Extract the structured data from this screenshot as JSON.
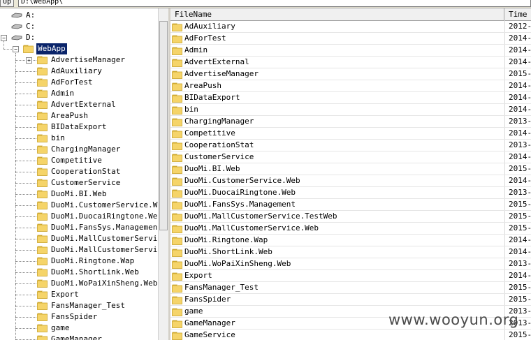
{
  "toolbar": {
    "up_label": "Up",
    "path": "D:\\WebApp\\"
  },
  "tree": {
    "drives": [
      {
        "label": "A:",
        "expanded": false
      },
      {
        "label": "C:",
        "expanded": false
      },
      {
        "label": "D:",
        "expanded": true
      }
    ],
    "selected_folder": "WebApp",
    "children": [
      {
        "label": "AdvertiseManager",
        "has_children": true
      },
      {
        "label": "AdAuxiliary"
      },
      {
        "label": "AdForTest"
      },
      {
        "label": "Admin"
      },
      {
        "label": "AdvertExternal"
      },
      {
        "label": "AreaPush"
      },
      {
        "label": "BIDataExport"
      },
      {
        "label": "bin"
      },
      {
        "label": "ChargingManager"
      },
      {
        "label": "Competitive"
      },
      {
        "label": "CooperationStat"
      },
      {
        "label": "CustomerService"
      },
      {
        "label": "DuoMi.BI.Web"
      },
      {
        "label": "DuoMi.CustomerService.Web"
      },
      {
        "label": "DuoMi.DuocaiRingtone.Web"
      },
      {
        "label": "DuoMi.FansSys.Management"
      },
      {
        "label": "DuoMi.MallCustomerService.TestWeb"
      },
      {
        "label": "DuoMi.MallCustomerService.Web"
      },
      {
        "label": "DuoMi.Ringtone.Wap"
      },
      {
        "label": "DuoMi.ShortLink.Web"
      },
      {
        "label": "DuoMi.WoPaiXinSheng.Web"
      },
      {
        "label": "Export"
      },
      {
        "label": "FansManager_Test"
      },
      {
        "label": "FansSpider"
      },
      {
        "label": "game"
      },
      {
        "label": "GameManager"
      }
    ]
  },
  "list": {
    "columns": [
      "FileName",
      "Time"
    ],
    "rows": [
      {
        "name": "AdAuxiliary",
        "time": "2012-"
      },
      {
        "name": "AdForTest",
        "time": "2014-"
      },
      {
        "name": "Admin",
        "time": "2014-"
      },
      {
        "name": "AdvertExternal",
        "time": "2014-"
      },
      {
        "name": "AdvertiseManager",
        "time": "2015-"
      },
      {
        "name": "AreaPush",
        "time": "2014-"
      },
      {
        "name": "BIDataExport",
        "time": "2014-"
      },
      {
        "name": "bin",
        "time": "2014-"
      },
      {
        "name": "ChargingManager",
        "time": "2013-"
      },
      {
        "name": "Competitive",
        "time": "2014-"
      },
      {
        "name": "CooperationStat",
        "time": "2013-"
      },
      {
        "name": "CustomerService",
        "time": "2014-"
      },
      {
        "name": "DuoMi.BI.Web",
        "time": "2015-"
      },
      {
        "name": "DuoMi.CustomerService.Web",
        "time": "2014-"
      },
      {
        "name": "DuoMi.DuocaiRingtone.Web",
        "time": "2013-"
      },
      {
        "name": "DuoMi.FansSys.Management",
        "time": "2015-"
      },
      {
        "name": "DuoMi.MallCustomerService.TestWeb",
        "time": "2015-"
      },
      {
        "name": "DuoMi.MallCustomerService.Web",
        "time": "2015-"
      },
      {
        "name": "DuoMi.Ringtone.Wap",
        "time": "2014-"
      },
      {
        "name": "DuoMi.ShortLink.Web",
        "time": "2014-"
      },
      {
        "name": "DuoMi.WoPaiXinSheng.Web",
        "time": "2013-"
      },
      {
        "name": "Export",
        "time": "2014-"
      },
      {
        "name": "FansManager_Test",
        "time": "2015-"
      },
      {
        "name": "FansSpider",
        "time": "2015-"
      },
      {
        "name": "game",
        "time": "2013-"
      },
      {
        "name": "GameManager",
        "time": "2013-"
      },
      {
        "name": "GameService",
        "time": "2015-"
      }
    ]
  },
  "watermark": "www.wooyun.org",
  "colors": {
    "selection": "#0a246a",
    "folder": "#f5d469",
    "folder_edge": "#c9a227",
    "chrome": "#ece9d8"
  }
}
